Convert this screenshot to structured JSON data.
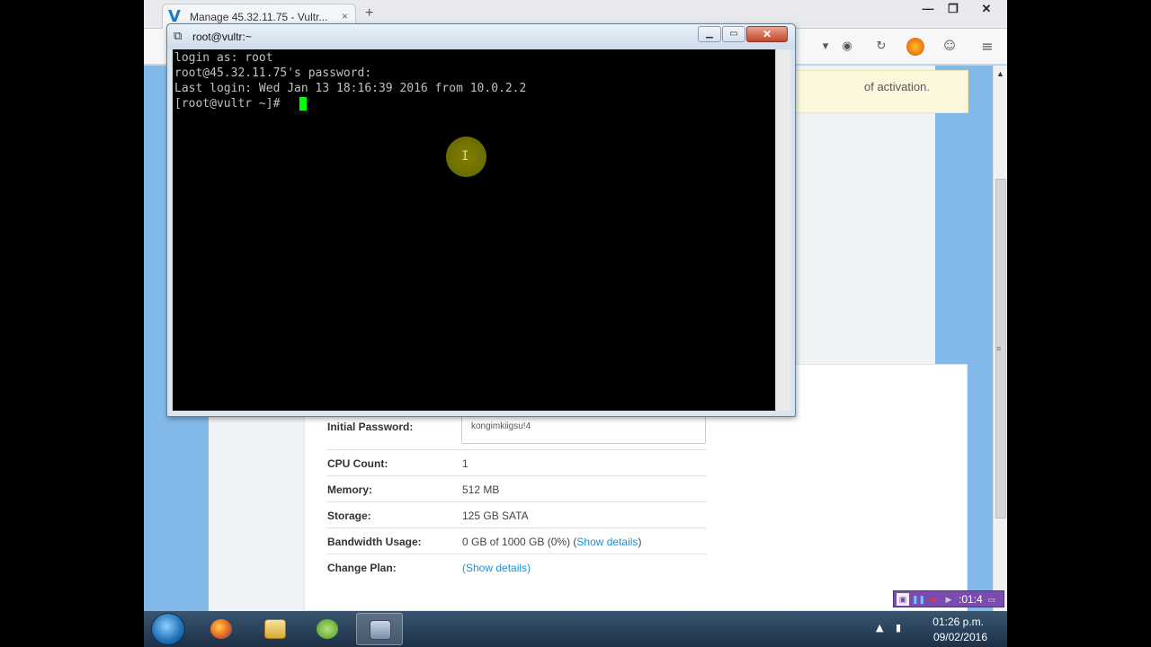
{
  "browser": {
    "tab_title": "Manage 45.32.11.75 - Vultr...",
    "tab_favicon": "V",
    "tab_close": "×",
    "new_tab": "+"
  },
  "window_controls": {
    "minimize": "—",
    "maximize": "❐",
    "close": "✕"
  },
  "page": {
    "notice_text": "of activation.",
    "server_info": [
      {
        "label": "Initial Password:",
        "value": "kongimkiigsu!4",
        "type": "password"
      },
      {
        "label": "CPU Count:",
        "value": "1"
      },
      {
        "label": "Memory:",
        "value": "512 MB"
      },
      {
        "label": "Storage:",
        "value": "125 GB SATA"
      },
      {
        "label": "Bandwidth Usage:",
        "value": "0 GB of 1000 GB (0%) (",
        "link": "Show details",
        "suffix": ")"
      },
      {
        "label": "Change Plan:",
        "link": "(Show details)"
      }
    ]
  },
  "putty": {
    "title": "root@vultr:~",
    "lines": [
      "login as: root",
      "root@45.32.11.75's password:",
      "Last login: Wed Jan 13 18:16:39 2016 from 10.0.2.2",
      "[root@vultr ~]# "
    ],
    "cursor_color": "#00ff00"
  },
  "recorder": {
    "time": ":01:4"
  },
  "taskbar": {
    "time": "01:26 p.m.",
    "date": "09/02/2016",
    "apps": [
      "windows-start",
      "firefox",
      "file-explorer",
      "spring-tool",
      "putty"
    ]
  },
  "colors": {
    "page_background": "#83b9e8",
    "link": "#1e8fd6",
    "terminal_bg": "#000000",
    "terminal_text": "#c0c0c0"
  }
}
